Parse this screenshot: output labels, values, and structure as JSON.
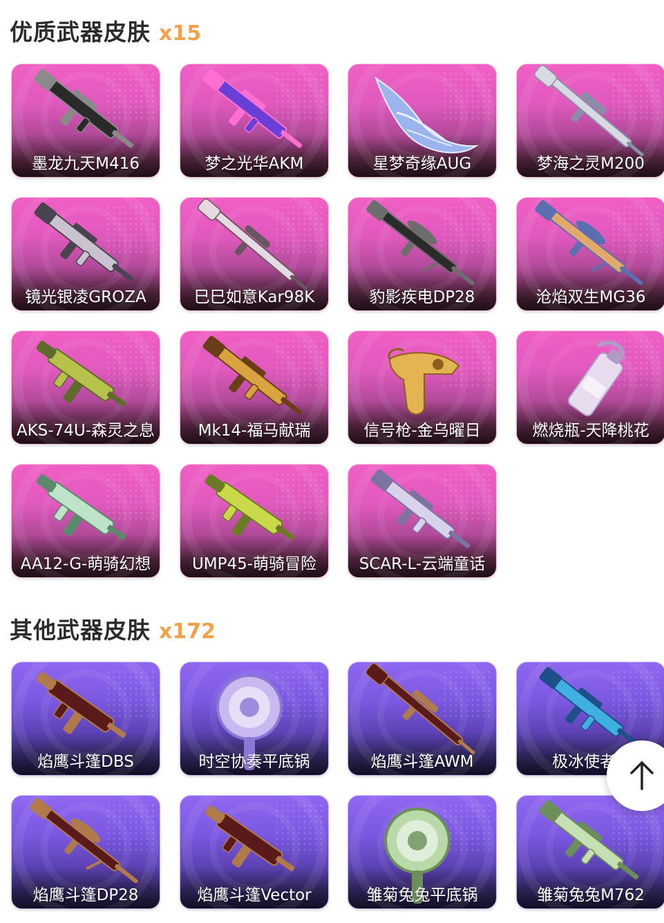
{
  "sections": [
    {
      "title": "优质武器皮肤",
      "count": "x15",
      "items": [
        {
          "name": "墨龙九天M416",
          "art": "rifle",
          "color": "#2a2a2a",
          "accent": "#8a8a8a"
        },
        {
          "name": "梦之光华AKM",
          "art": "rifle",
          "color": "#6a3fd8",
          "accent": "#ff6fd0"
        },
        {
          "name": "星梦奇缘AUG",
          "art": "wing",
          "color": "#9bb4ee",
          "accent": "#e8efff"
        },
        {
          "name": "梦海之灵M200",
          "art": "sniper",
          "color": "#d9d9e4",
          "accent": "#8a8fa8"
        },
        {
          "name": "镜光银凌GROZA",
          "art": "rifle",
          "color": "#c8c3cf",
          "accent": "#4a4450"
        },
        {
          "name": "巳巳如意Kar98K",
          "art": "sniper",
          "color": "#e6d9e2",
          "accent": "#6b5560"
        },
        {
          "name": "豹影疾电DP28",
          "art": "lmg",
          "color": "#2b2b2b",
          "accent": "#6d6d6d"
        },
        {
          "name": "沧焰双生MG36",
          "art": "lmg",
          "color": "#e2a96a",
          "accent": "#5b6fb0"
        },
        {
          "name": "AKS-74U-森灵之息",
          "art": "smg",
          "color": "#b7c24a",
          "accent": "#5f6b2a"
        },
        {
          "name": "Mk14-福马献瑞",
          "art": "rifle",
          "color": "#d9a33f",
          "accent": "#6b3e1a"
        },
        {
          "name": "信号枪-金乌曜日",
          "art": "pistol",
          "color": "#e2b452",
          "accent": "#8c5f1e"
        },
        {
          "name": "燃烧瓶-天降桃花",
          "art": "bottle",
          "color": "#e8dcef",
          "accent": "#b09ac6"
        },
        {
          "name": "AA12-G-萌骑幻想",
          "art": "smg",
          "color": "#bfe3c9",
          "accent": "#5a8a6b"
        },
        {
          "name": "UMP45-萌骑冒险",
          "art": "smg",
          "color": "#c9d94a",
          "accent": "#6b7a24"
        },
        {
          "name": "SCAR-L-云端童话",
          "art": "rifle",
          "color": "#d8d2ea",
          "accent": "#7c73a0"
        }
      ]
    },
    {
      "title": "其他武器皮肤",
      "count": "x172",
      "items": [
        {
          "name": "焰鹰斗篷DBS",
          "art": "smg",
          "color": "#5a1a1a",
          "accent": "#b07a4a"
        },
        {
          "name": "时空协奏平底锅",
          "art": "pan",
          "color": "#c9b9f0",
          "accent": "#8c76d6"
        },
        {
          "name": "焰鹰斗篷AWM",
          "art": "sniper",
          "color": "#5a1a1a",
          "accent": "#b07a4a"
        },
        {
          "name": "极冰使者M",
          "art": "rifle",
          "color": "#3fb0e0",
          "accent": "#1f4f8a"
        },
        {
          "name": "焰鹰斗篷DP28",
          "art": "lmg",
          "color": "#5a1a1a",
          "accent": "#b07a4a"
        },
        {
          "name": "焰鹰斗篷Vector",
          "art": "smg",
          "color": "#5a1a1a",
          "accent": "#b07a4a"
        },
        {
          "name": "雏菊兔兔平底锅",
          "art": "pan",
          "color": "#b9d9a8",
          "accent": "#6c8f5a"
        },
        {
          "name": "雏菊兔兔M762",
          "art": "rifle",
          "color": "#c7e0b3",
          "accent": "#6c8f5a"
        }
      ]
    }
  ],
  "scroll_top": {
    "icon": "arrow-up-icon"
  }
}
